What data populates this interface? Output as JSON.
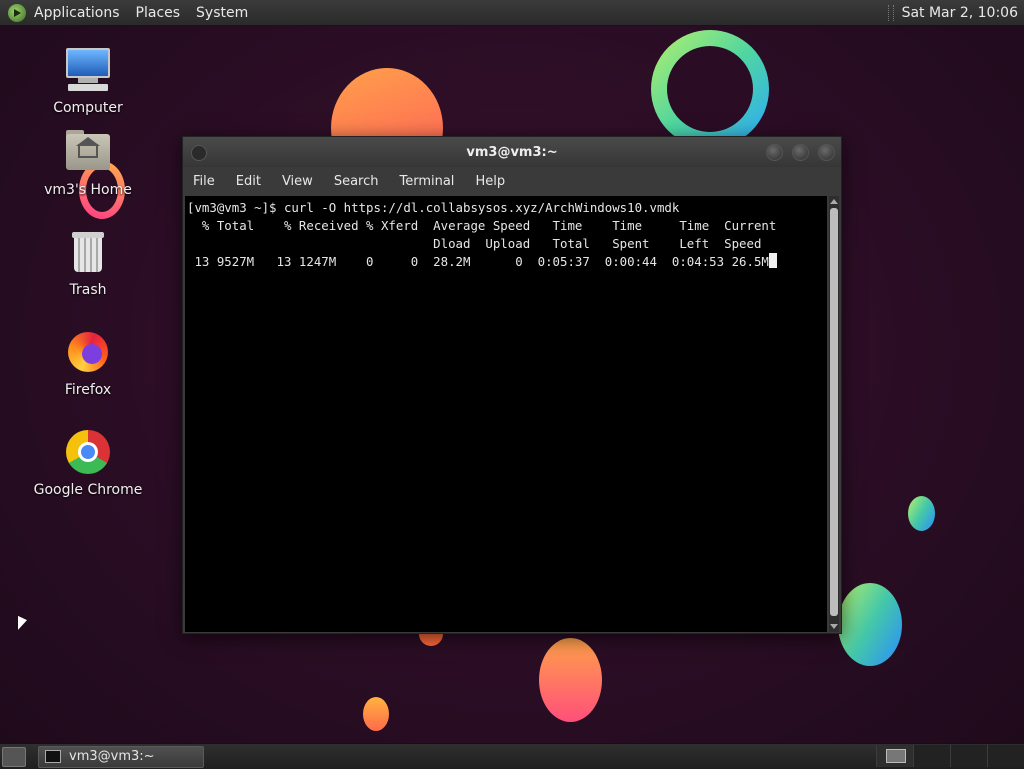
{
  "top_panel": {
    "menus": [
      "Applications",
      "Places",
      "System"
    ],
    "clock": "Sat Mar  2, 10:06"
  },
  "desktop": {
    "icons": [
      {
        "label": "Computer",
        "icon": "computer-icon"
      },
      {
        "label": "vm3's Home",
        "icon": "home-folder-icon"
      },
      {
        "label": "Trash",
        "icon": "trash-icon"
      },
      {
        "label": "Firefox",
        "icon": "firefox-icon"
      },
      {
        "label": "Google Chrome",
        "icon": "chrome-icon"
      }
    ]
  },
  "terminal": {
    "title": "vm3@vm3:~",
    "menu": [
      "File",
      "Edit",
      "View",
      "Search",
      "Terminal",
      "Help"
    ],
    "lines": [
      "[vm3@vm3 ~]$ curl -O https://dl.collabsysos.xyz/ArchWindows10.vmdk",
      "  % Total    % Received % Xferd  Average Speed   Time    Time     Time  Current",
      "                                 Dload  Upload   Total   Spent    Left  Speed",
      " 13 9527M   13 1247M    0     0  28.2M      0  0:05:37  0:00:44  0:04:53 26.5M"
    ]
  },
  "bottom_panel": {
    "task_label": "vm3@vm3:~"
  },
  "colors": {
    "desktop_bg": "#2a0d24",
    "terminal_bg": "#000000",
    "terminal_fg": "#e6e6e6",
    "panel_bg": "#2f2f2f"
  }
}
